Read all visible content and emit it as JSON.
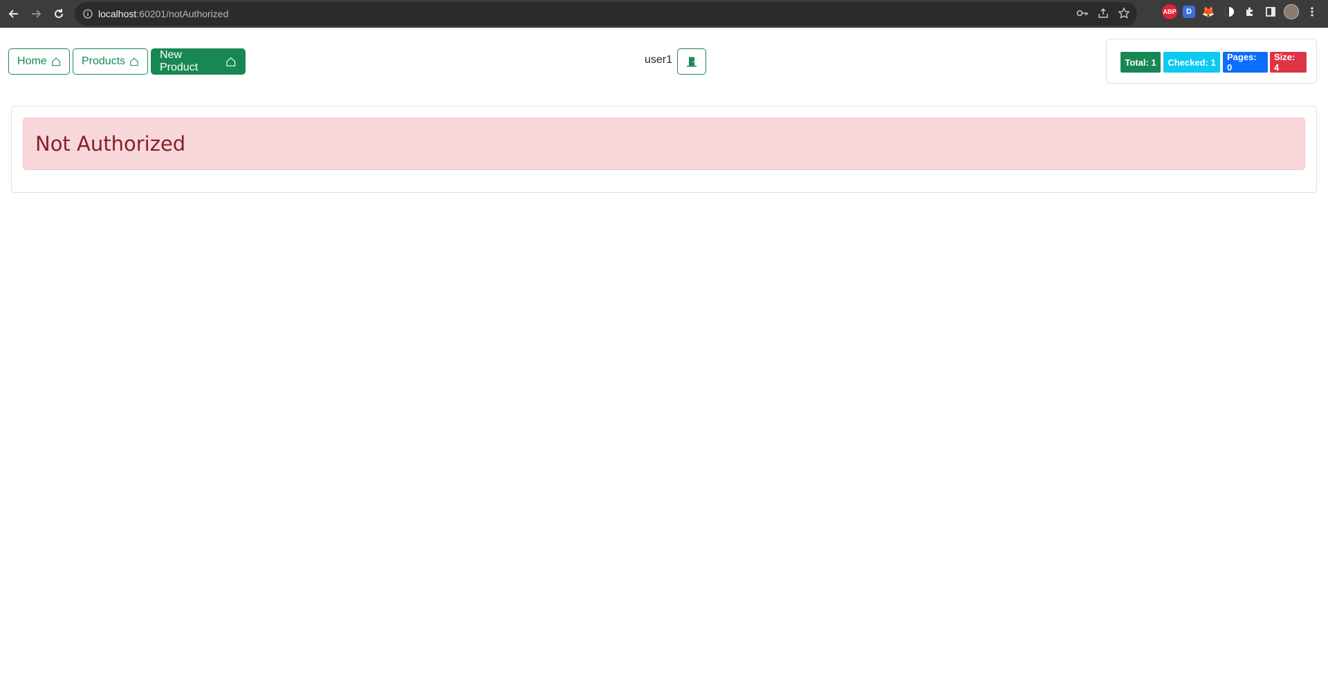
{
  "browser": {
    "url_host": "localhost",
    "url_rest": ":60201/notAuthorized",
    "extensions": [
      {
        "name": "adblock-plus-icon",
        "label": "ABP",
        "color": "#e0233a"
      },
      {
        "name": "dashlane-icon",
        "label": "D",
        "color": "#3a6fe0"
      },
      {
        "name": "metamask-icon",
        "label": "🦊",
        "color": "#3c3c3c"
      },
      {
        "name": "dark-mode-icon",
        "label": "",
        "color": "#ffffff"
      },
      {
        "name": "extensions-puzzle-icon",
        "label": "",
        "color": "#3c3c3c"
      },
      {
        "name": "side-panel-icon",
        "label": "",
        "color": "#3c3c3c"
      },
      {
        "name": "profile-avatar-icon",
        "label": "",
        "color": "#8a7a70"
      }
    ]
  },
  "nav": {
    "home_label": "Home",
    "products_label": "Products",
    "new_product_label": "New Product"
  },
  "user": {
    "name": "user1"
  },
  "stats": {
    "total": "Total: 1",
    "checked": "Checked: 1",
    "pages": "Pages: 0",
    "size": "Size: 4",
    "colors": {
      "total": "#198754",
      "checked": "#0dcaf0",
      "pages": "#0d6efd",
      "size": "#dc3545"
    }
  },
  "main": {
    "alert_text": "Not Authorized"
  },
  "colors": {
    "accent": "#198754",
    "alert_bg": "#f8d7da",
    "alert_text": "#842029"
  }
}
